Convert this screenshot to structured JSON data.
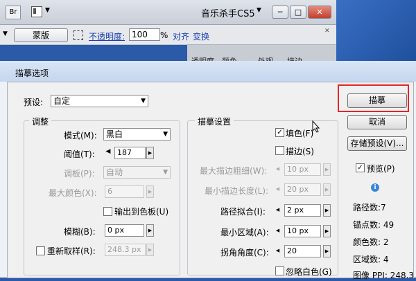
{
  "appbar": {
    "br_label": "Br",
    "doc_title": "音乐杀手CS5",
    "min": "─",
    "max": "□",
    "close": "✕"
  },
  "optbar": {
    "mask_button": "蒙版",
    "opacity_label": "不透明度:",
    "opacity_value": "100",
    "percent": "%",
    "link_align": "对齐",
    "link_transform": "变换"
  },
  "panel_tabs": [
    "透明度",
    "颜色",
    "外观",
    "描边"
  ],
  "dialog": {
    "title": "描摹选项",
    "preset_label": "预设:",
    "preset_value": "自定",
    "adjust": {
      "group_title": "调整",
      "mode_label": "模式(M):",
      "mode_value": "黑白",
      "threshold_label": "阈值(T):",
      "threshold_value": "187",
      "palette_label": "调板(P):",
      "palette_value": "自动",
      "max_colors_label": "最大颜色(X):",
      "max_colors_value": "6",
      "output_swatches_label": "输出到色板(U)",
      "blur_label": "模糊(B):",
      "blur_value": "0 px",
      "resample_label": "重新取样(R):",
      "resample_value": "248.3 px"
    },
    "trace": {
      "group_title": "描摹设置",
      "fill_label": "填色(F)",
      "stroke_label": "描边(S)",
      "max_stroke_weight_label": "最大描边粗细(W):",
      "max_stroke_weight_value": "10 px",
      "min_stroke_length_label": "最小描边长度(L):",
      "min_stroke_length_value": "20 px",
      "path_fitting_label": "路径拟合(I):",
      "path_fitting_value": "2 px",
      "min_area_label": "最小区域(A):",
      "min_area_value": "10 px",
      "corner_angle_label": "拐角角度(C):",
      "corner_angle_value": "20",
      "ignore_white_label": "忽略白色(G)"
    },
    "buttons": {
      "trace": "描摹",
      "cancel": "取消",
      "save_preset": "存储预设(V)...",
      "preview": "预览(P)"
    },
    "stats": {
      "paths": "路径数:7",
      "anchors": "锚点数: 49",
      "colors": "颜色数: 2",
      "areas": "区域数: 4",
      "image_ppi": "图像 PPI: 248.3"
    }
  },
  "colors": {
    "highlight_frame": "#e0262b",
    "desktop": "#2a5aa8"
  }
}
